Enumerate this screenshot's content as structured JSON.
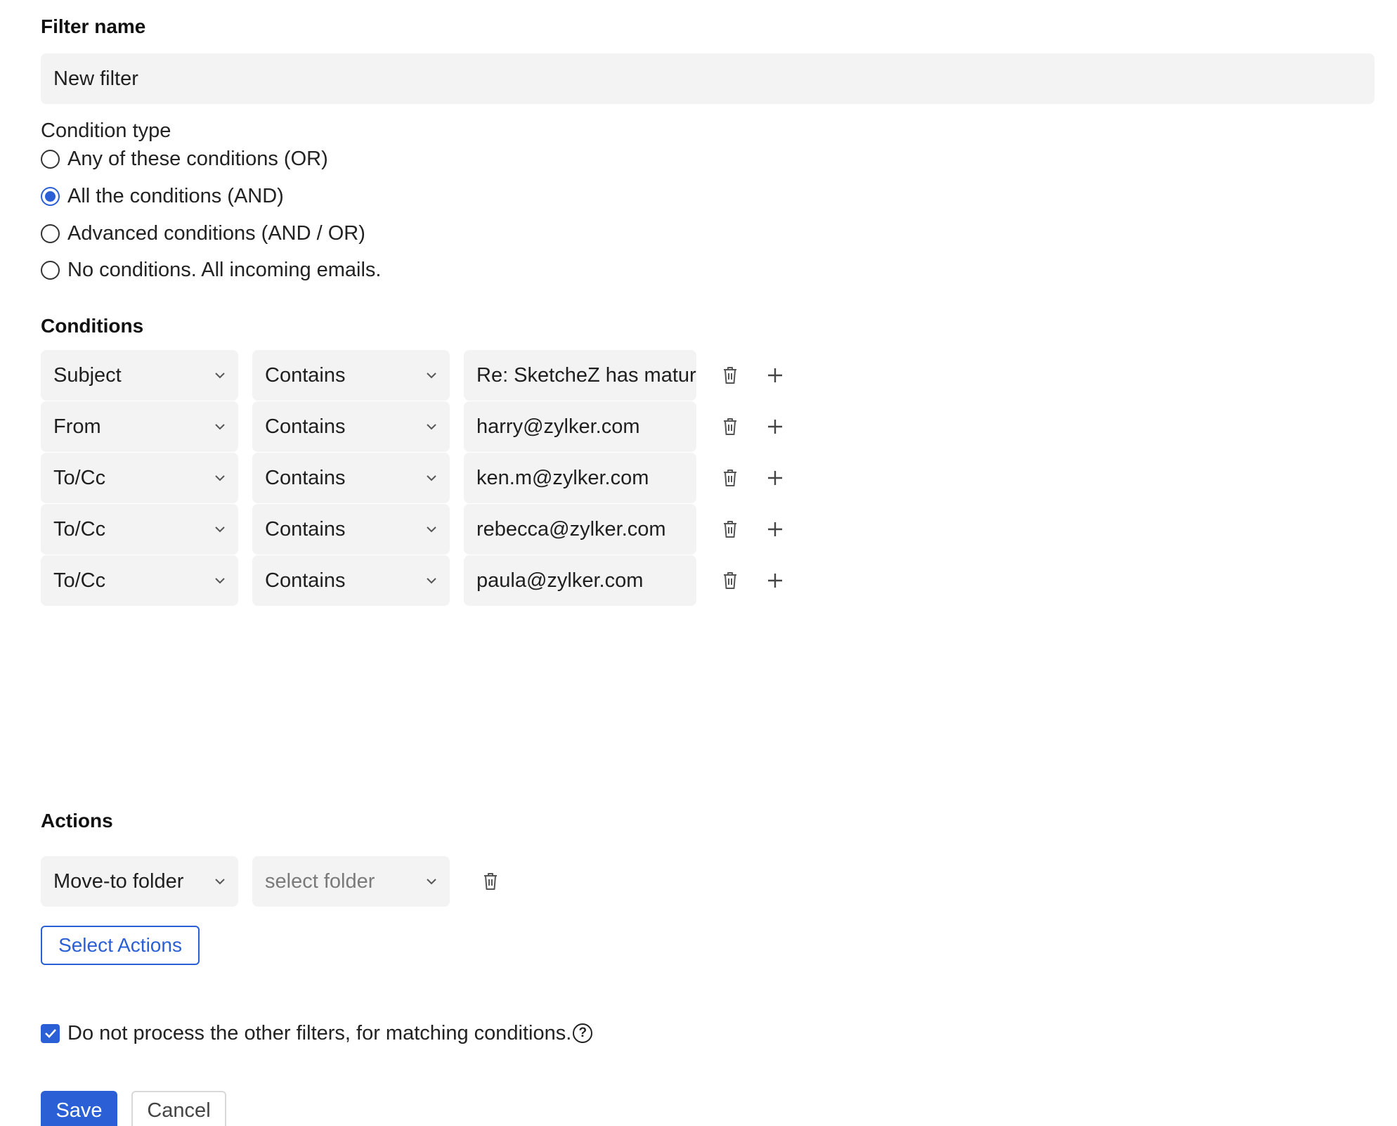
{
  "filter_name": {
    "label": "Filter name",
    "value": "New filter"
  },
  "condition_type": {
    "label": "Condition type",
    "options": [
      {
        "label": "Any of these conditions (OR)",
        "checked": false
      },
      {
        "label": "All the conditions (AND)",
        "checked": true
      },
      {
        "label": "Advanced conditions (AND / OR)",
        "checked": false
      },
      {
        "label": "No conditions. All incoming emails.",
        "checked": false
      }
    ]
  },
  "conditions": {
    "label": "Conditions",
    "rows": [
      {
        "field": "Subject",
        "operator": "Contains",
        "value": "Re: SketcheZ has mature"
      },
      {
        "field": "From",
        "operator": "Contains",
        "value": "harry@zylker.com"
      },
      {
        "field": "To/Cc",
        "operator": "Contains",
        "value": "ken.m@zylker.com"
      },
      {
        "field": "To/Cc",
        "operator": "Contains",
        "value": "rebecca@zylker.com"
      },
      {
        "field": "To/Cc",
        "operator": "Contains",
        "value": "paula@zylker.com"
      }
    ]
  },
  "actions": {
    "label": "Actions",
    "action": "Move-to folder",
    "folder_placeholder": "select folder",
    "select_actions_label": "Select Actions"
  },
  "stop_processing": {
    "label": "Do not process the other filters, for matching conditions.",
    "checked": true,
    "help_glyph": "?"
  },
  "footer": {
    "save_label": "Save",
    "cancel_label": "Cancel"
  },
  "colors": {
    "accent": "#2a5fd6",
    "field_bg": "#f3f3f3"
  }
}
